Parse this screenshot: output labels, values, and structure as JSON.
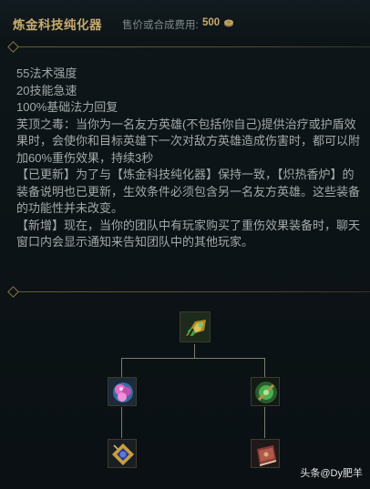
{
  "item": {
    "name": "炼金科技纯化器",
    "cost_label": "售价或合成费用:",
    "cost_value": "500",
    "cost_icon": "gold-coin-icon"
  },
  "description": [
    "55法术强度",
    "20技能急速",
    "100%基础法力回复",
    "芙顶之毒：当你为一名友方英雄(不包括你自己)提供治疗或护盾效果时，会使你和目标英雄下一次对敌方英雄造成伤害时，都可以附加60%重伤效果，持续3秒",
    "【已更新】为了与【炼金科技纯化器】保持一致，【炽热香炉】的装备说明也已更新，生效条件必须包含另一名友方英雄。这些装备的功能性并未改变。",
    "【新增】现在，当你的团队中有玩家购买了重伤效果装备时，聊天窗口内会显示通知来告知团队中的其他玩家。"
  ],
  "recipe_tree": {
    "root_icon": "alchemy-purifier-icon",
    "left_component_icon": "pink-crystal-bloom-icon",
    "right_component_icon": "green-orb-icon",
    "left_subcomponent_icon": "blue-gem-amulet-icon",
    "right_subcomponent_icon": "red-tome-icon"
  },
  "watermark": "头条@Dy肥羊",
  "colors": {
    "title_gold": "#c8aa6e",
    "text": "#a3a8a9",
    "background": "#0b1114",
    "line": "#7b7c72"
  }
}
